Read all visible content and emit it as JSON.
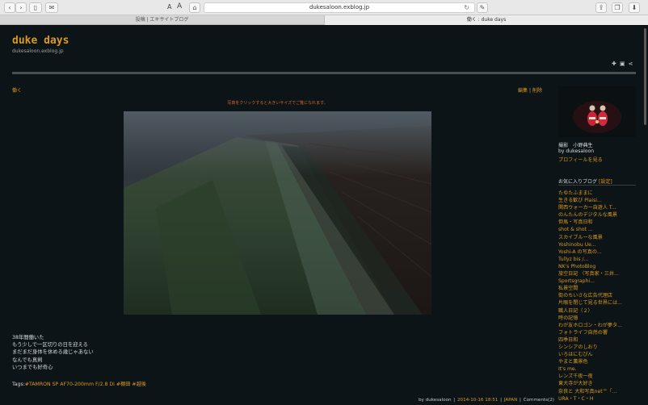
{
  "browser": {
    "url": "dukesaloon.exblog.jp",
    "font_small": "A",
    "font_large": "A",
    "tabs": [
      {
        "label": "投稿 | エキサイトブログ",
        "active": false
      },
      {
        "label": "働く : duke days",
        "active": true
      }
    ]
  },
  "header": {
    "title": "duke days",
    "subtitle": "dukesaloon.exblog.jp"
  },
  "post": {
    "title": "働く",
    "edit": "編集",
    "delete": "削除",
    "separator": "|",
    "photo_hint": "写真をクリックすると大きいサイズでご覧になれます。",
    "body_lines": [
      "38年間働いた",
      "もう少しで一区切りの日を迎える",
      "まだまだ身体を休める歳じゃあない",
      "なんでも真剣",
      "いつまでも好奇心"
    ],
    "tags_label": "Tags:",
    "tags": [
      "#TAMRON SP AF70-200mm F/2.8 Di",
      "#棚田",
      "#越後"
    ],
    "footer": {
      "by": "by dukesaloon",
      "date": "2014-10-16 18:51",
      "category": "JAPAN",
      "comments": "Comments(2)"
    }
  },
  "sidebar": {
    "photographer": "撮影　小野典生",
    "by": "by dukesaloon",
    "profile_link": "プロフィールを見る",
    "favorites_title": "お気に入りブログ",
    "favorites_setting": "[設定]",
    "favorites": [
      "たゆたふままに",
      "生きる歓び Plaisi...",
      "関西ウォーカー自遊人 T...",
      "のんたんのデジタルな風景",
      "但馬・写真日和",
      "shot & shot ...",
      "スカイブルーな風景",
      "Yoshinobu Ue...",
      "Yoshi-A の写真の...",
      "Tullyz bis /...",
      "NK's PhotoBlog",
      "旅空日記 （写真家・三井...",
      "Sportsgraphi...",
      "私景空間",
      "街のちいさな広告代理店",
      "片眼を閉じて見る世界には...",
      "職人日記（２）",
      "時の記憶",
      "わが友ホロゴン・わが夢タ...",
      "フォトライフ自然の響",
      "四季日和",
      "シンシアのしおり",
      "いろはにむぴん",
      "やまと薫景色",
      "It's me.",
      "レンズ千夜一夜",
      "東大寺が大好き",
      "奈良と 大和写真net™「...",
      "URA・T・C・H"
    ]
  }
}
